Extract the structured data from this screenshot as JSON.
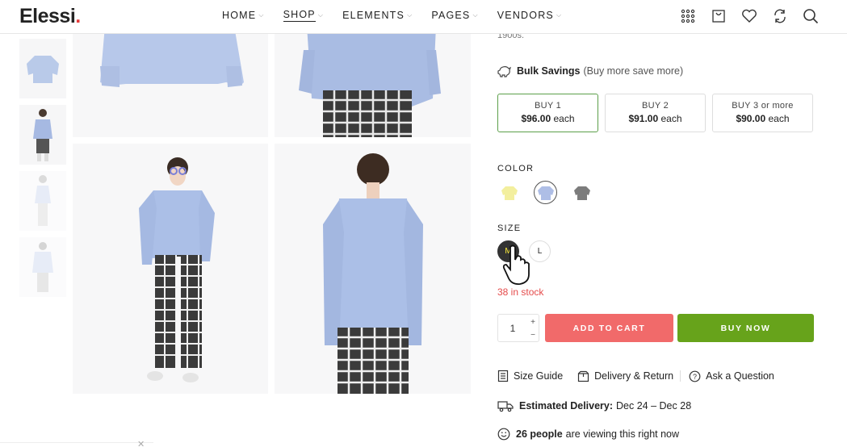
{
  "header": {
    "logo": "Elessi",
    "logo_dot": ".",
    "nav": [
      {
        "label": "HOME",
        "active": false
      },
      {
        "label": "SHOP",
        "active": true
      },
      {
        "label": "ELEMENTS",
        "active": false
      },
      {
        "label": "PAGES",
        "active": false
      },
      {
        "label": "VENDORS",
        "active": false
      }
    ],
    "icons": [
      "grid-icon",
      "shopping-bag-icon",
      "heart-icon",
      "compare-icon",
      "search-icon"
    ]
  },
  "product": {
    "truncated_text": "1900s.",
    "bulk_savings": {
      "title": "Bulk Savings",
      "note": "(Buy more save more)"
    },
    "tiers": [
      {
        "label": "BUY 1",
        "price": "$96.00",
        "unit": "each",
        "selected": true
      },
      {
        "label": "BUY 2",
        "price": "$91.00",
        "unit": "each",
        "selected": false
      },
      {
        "label": "BUY 3 or more",
        "price": "$90.00",
        "unit": "each",
        "selected": false
      }
    ],
    "color_label": "COLOR",
    "colors": [
      {
        "name": "yellow",
        "hex": "#f5f0a0",
        "selected": false
      },
      {
        "name": "blue",
        "hex": "#aebee6",
        "selected": true
      },
      {
        "name": "gray",
        "hex": "#7c7c7c",
        "selected": false
      }
    ],
    "size_label": "SIZE",
    "sizes": [
      {
        "label": "M",
        "selected": true
      },
      {
        "label": "L",
        "selected": false
      }
    ],
    "stock": "38 in stock",
    "quantity": "1",
    "qty_plus": "+",
    "qty_minus": "−",
    "add_to_cart": "ADD TO CART",
    "buy_now": "BUY NOW",
    "links": {
      "size_guide": "Size Guide",
      "delivery_return": "Delivery & Return",
      "ask_question": "Ask a Question"
    },
    "delivery": {
      "label": "Estimated Delivery:",
      "value": "Dec 24 – Dec 28"
    },
    "viewers": {
      "count": "26 people",
      "suffix": "are viewing this right now"
    }
  },
  "colors": {
    "accent_green": "#67a31b",
    "cart_red": "#f16a6a",
    "stock_red": "#e54b4b",
    "selected_border": "#5c9f4a"
  }
}
